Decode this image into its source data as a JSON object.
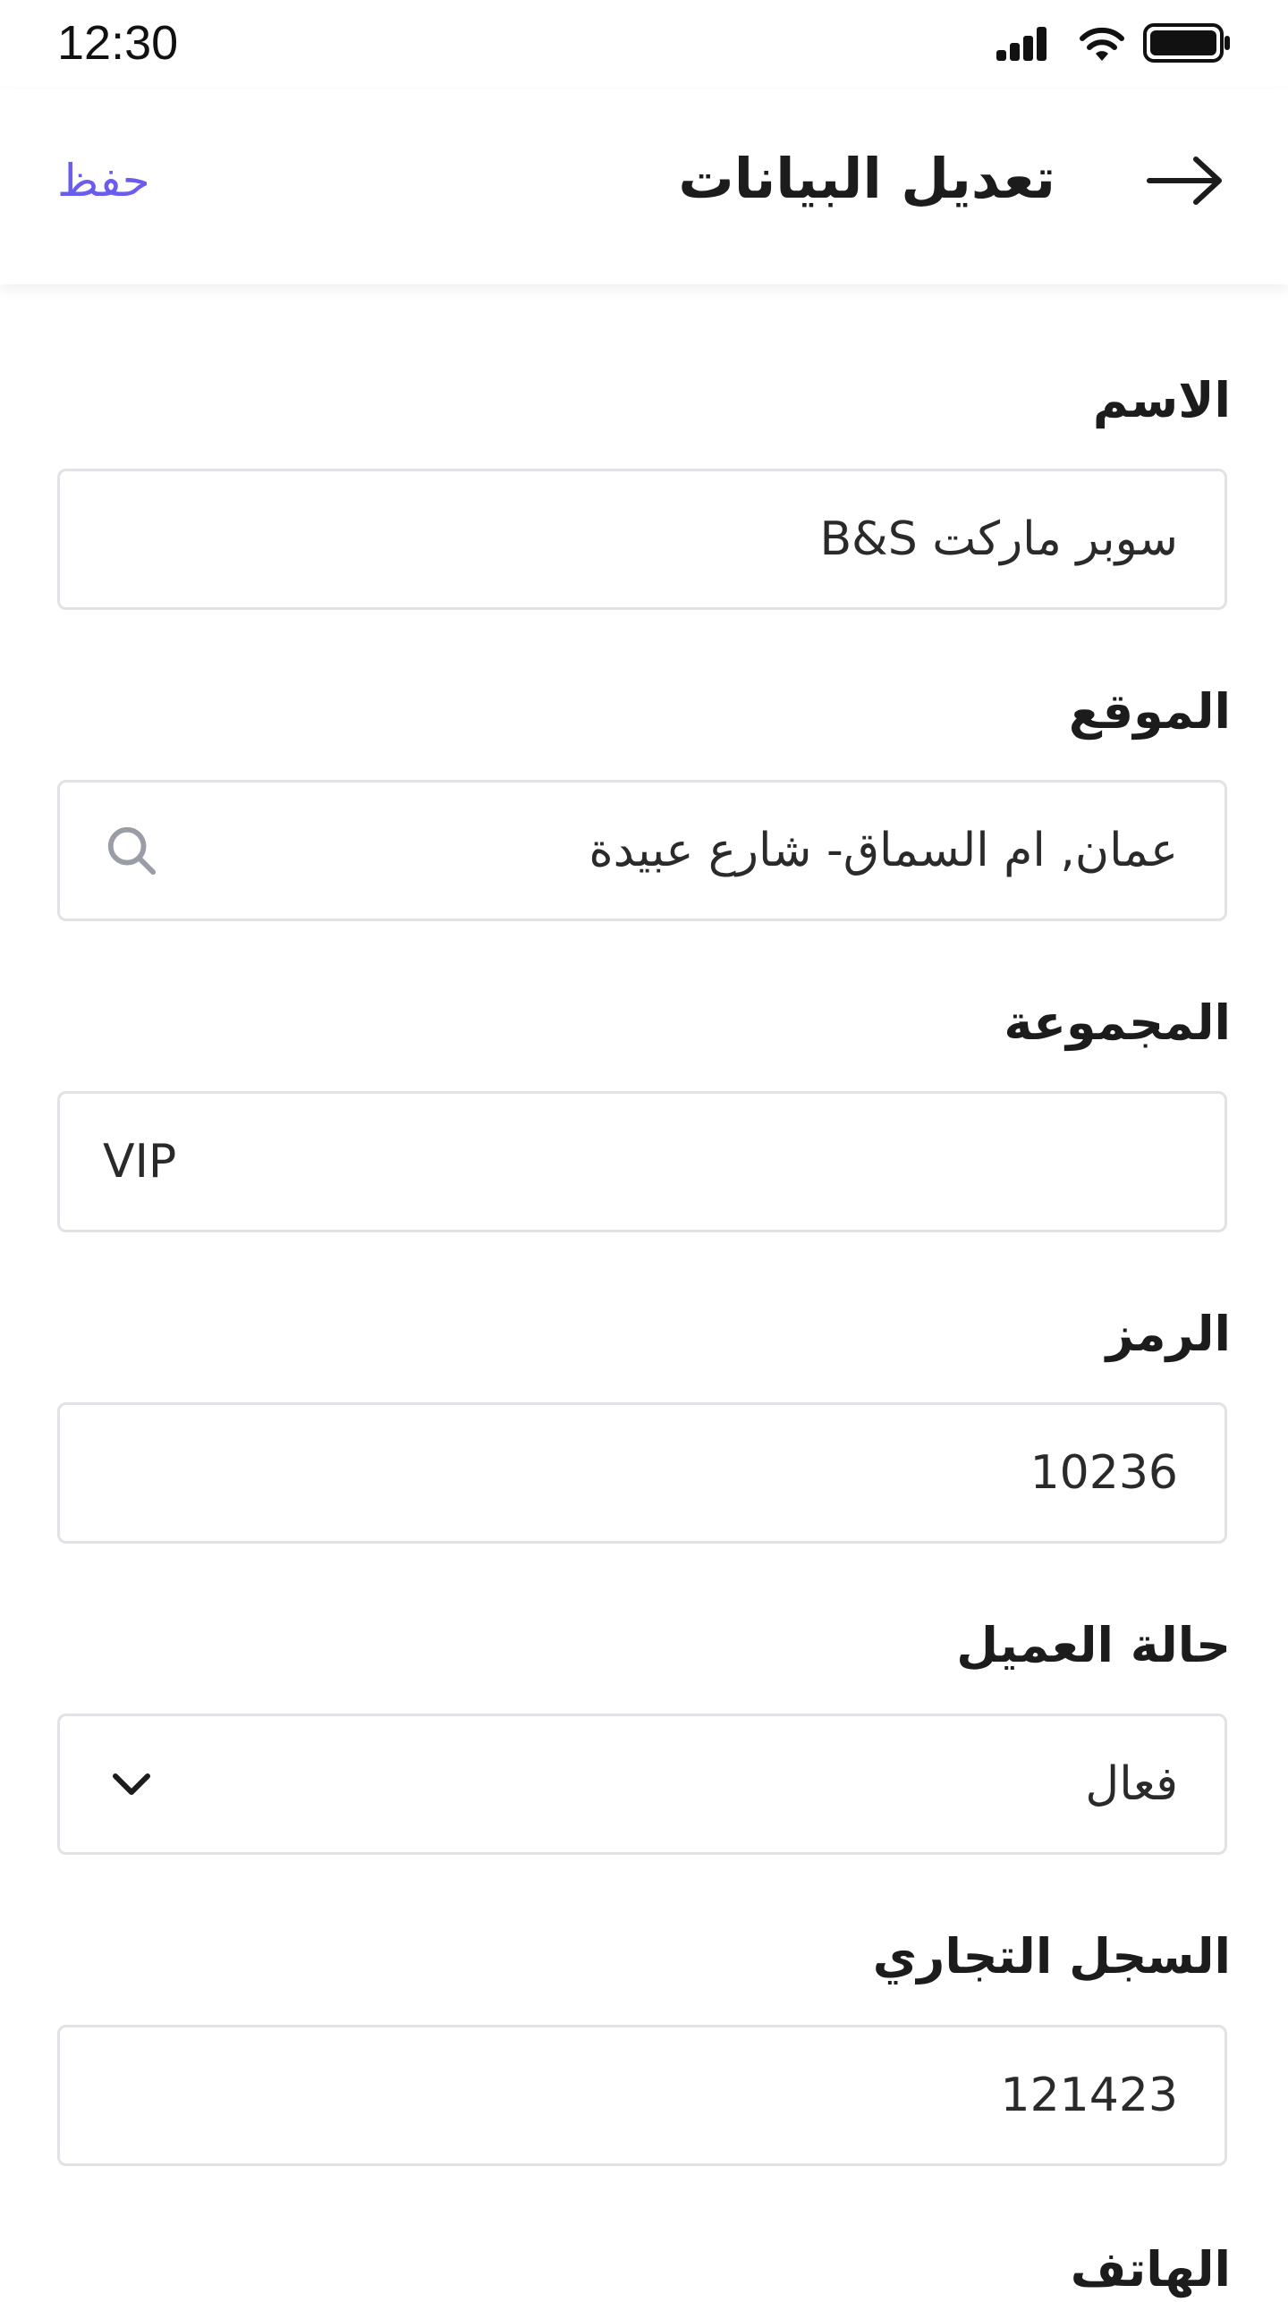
{
  "status_bar": {
    "time": "12:30",
    "icons": [
      "signal-icon",
      "wifi-icon",
      "battery-icon"
    ]
  },
  "header": {
    "title": "تعديل البيانات",
    "save_label": "حفظ",
    "back_icon": "arrow-right-icon"
  },
  "colors": {
    "accent": "#6b5cf0",
    "border": "#e2e2e6",
    "icon_gray": "#9a9ca6"
  },
  "form": {
    "name": {
      "label": "الاسم",
      "value": "سوبر ماركت B&S"
    },
    "location": {
      "label": "الموقع",
      "value": "عمان, ام السماق- شارع عبيدة",
      "icon": "search-icon"
    },
    "group": {
      "label": "المجموعة",
      "value": "VIP"
    },
    "code": {
      "label": "الرمز",
      "value": "10236"
    },
    "status": {
      "label": "حالة العميل",
      "value": "فعال",
      "icon": "chevron-down-icon"
    },
    "commercial_register": {
      "label": "السجل التجاري",
      "value": "121423"
    },
    "phone": {
      "label": "الهاتف"
    }
  }
}
